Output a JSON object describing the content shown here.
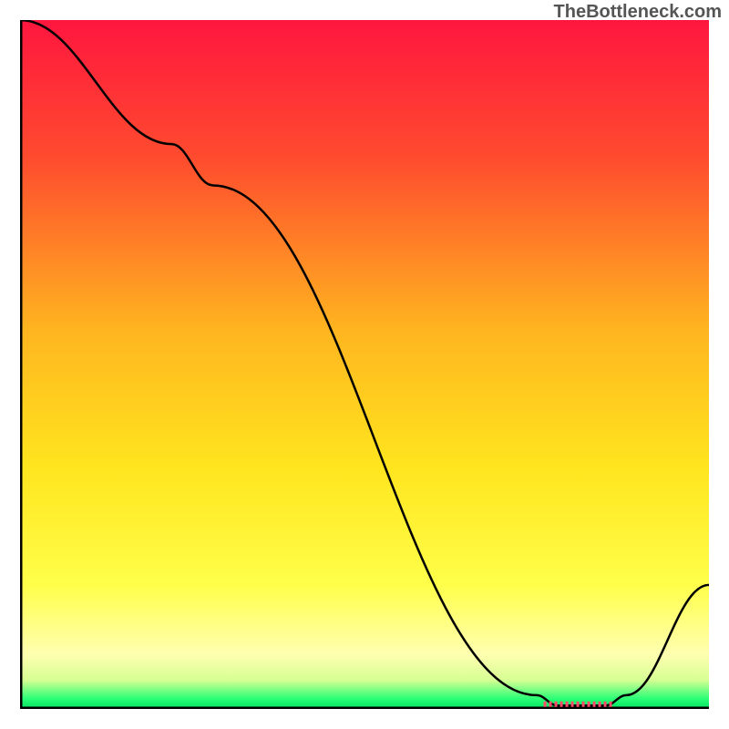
{
  "watermark": "TheBottleneck.com",
  "chart_data": {
    "type": "line",
    "title": "",
    "xlabel": "",
    "ylabel": "",
    "xlim": [
      0,
      100
    ],
    "ylim": [
      0,
      100
    ],
    "gradient_stops": [
      {
        "offset": 0.0,
        "color": "#ff163f"
      },
      {
        "offset": 0.2,
        "color": "#ff4b2e"
      },
      {
        "offset": 0.45,
        "color": "#ffb51f"
      },
      {
        "offset": 0.65,
        "color": "#ffe51e"
      },
      {
        "offset": 0.82,
        "color": "#ffff4a"
      },
      {
        "offset": 0.92,
        "color": "#ffffb0"
      },
      {
        "offset": 0.958,
        "color": "#d7ff94"
      },
      {
        "offset": 0.985,
        "color": "#2bff76"
      },
      {
        "offset": 1.0,
        "color": "#00e060"
      }
    ],
    "curve": [
      {
        "x": 0.0,
        "y": 100.0
      },
      {
        "x": 22.0,
        "y": 82.0
      },
      {
        "x": 28.0,
        "y": 76.0
      },
      {
        "x": 75.0,
        "y": 2.0
      },
      {
        "x": 78.0,
        "y": 0.5
      },
      {
        "x": 82.0,
        "y": 0.5
      },
      {
        "x": 85.0,
        "y": 0.5
      },
      {
        "x": 88.0,
        "y": 2.0
      },
      {
        "x": 100.0,
        "y": 18.0
      }
    ],
    "marker_segment": {
      "x_start": 76.0,
      "x_end": 86.0,
      "y": 0.7,
      "color": "#ff4b6a"
    },
    "axis_color": "#000000",
    "axis_width": 5
  }
}
